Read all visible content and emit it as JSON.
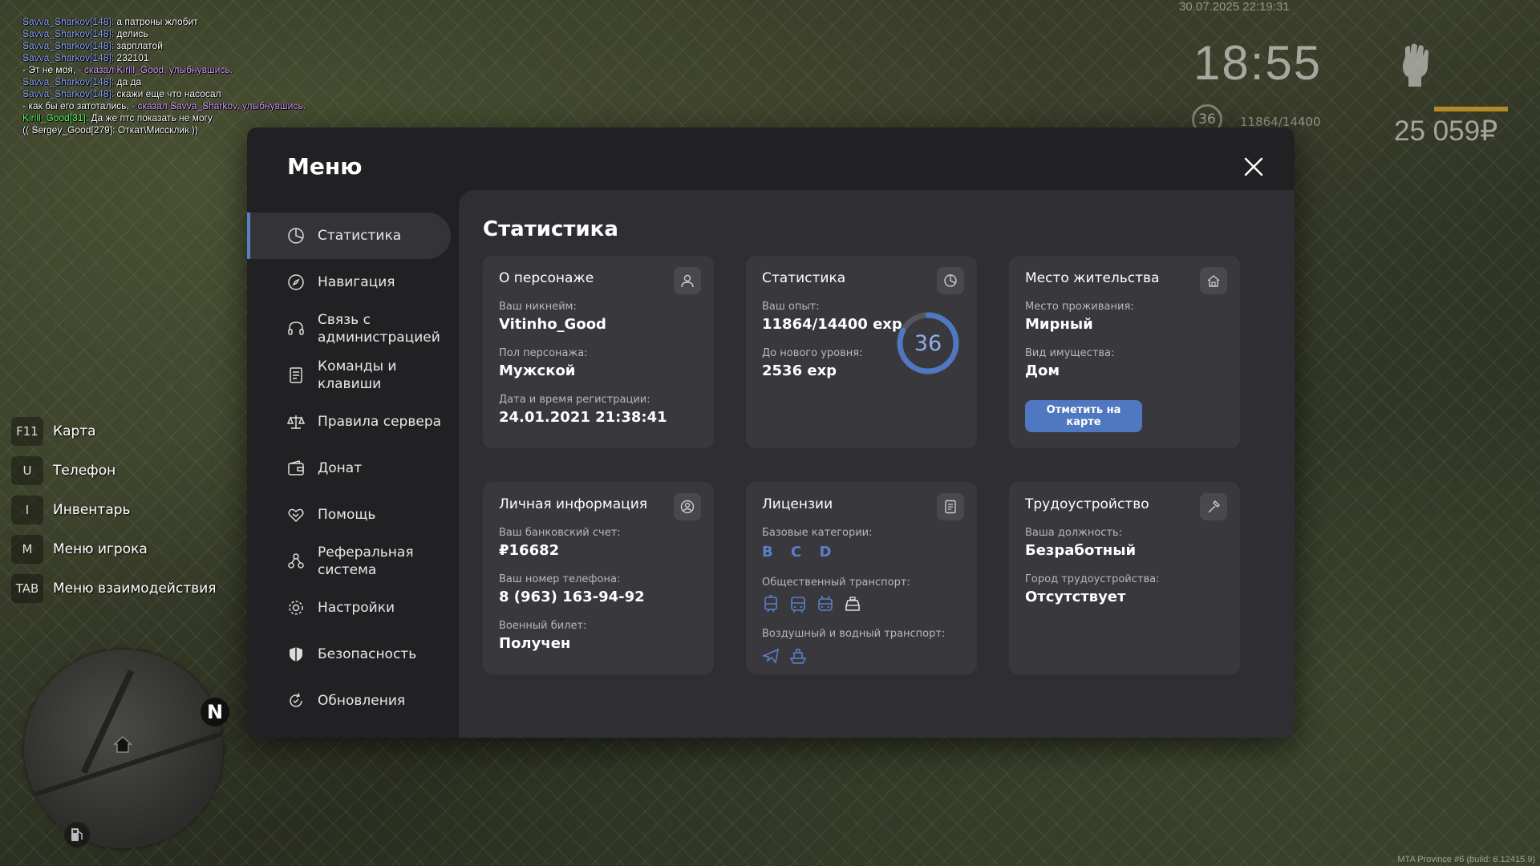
{
  "chat": [
    {
      "nick": "Savva_Sharkov[148]:",
      "text": " а патроны жлобит"
    },
    {
      "nick": "Savva_Sharkov[148]:",
      "text": " делись"
    },
    {
      "nick": "Savva_Sharkov[148]:",
      "text": " зарплатой"
    },
    {
      "nick": "Savva_Sharkov[148]:",
      "text": " 232101"
    },
    {
      "pre": "- Эт не моя, ",
      "act": "- сказал Kirill_Good, улыбнувшись."
    },
    {
      "nick": "Savva_Sharkov[148]:",
      "text": " да да"
    },
    {
      "nick": "Savva_Sharkov[148]:",
      "text": " скажи еще что насосал"
    },
    {
      "pre": "- как бы его затотались, ",
      "act": "- сказал Savva_Sharkov, улыбнувшись."
    },
    {
      "nick2": "Kirill_Good[31]:",
      "text": " Да же птс показать не могу"
    },
    {
      "pre": "(( Sergey_Good[279]: Откат\\Миссклик ))",
      "act": ""
    }
  ],
  "hud": {
    "datetime": "30.07.2025 22:19:31",
    "time": "18:55",
    "level": "36",
    "exp": "11864/14400",
    "money": "25 059₽",
    "compass": "N",
    "build": "MTA Province #6 (build: 6.12415.9)"
  },
  "binds": [
    {
      "key": "F11",
      "label": "Карта"
    },
    {
      "key": "U",
      "label": "Телефон"
    },
    {
      "key": "I",
      "label": "Инвентарь"
    },
    {
      "key": "M",
      "label": "Меню игрока"
    },
    {
      "key": "TAB",
      "label": "Меню взаимодействия"
    }
  ],
  "menu": {
    "title": "Меню",
    "section_title": "Статистика",
    "nav": [
      {
        "label": "Статистика",
        "icon": "pie-chart-icon"
      },
      {
        "label": "Навигация",
        "icon": "compass-icon"
      },
      {
        "label": "Связь с администрацией",
        "icon": "headset-icon"
      },
      {
        "label": "Команды и клавиши",
        "icon": "document-icon"
      },
      {
        "label": "Правила сервера",
        "icon": "scales-icon"
      },
      {
        "label": "Донат",
        "icon": "wallet-icon"
      },
      {
        "label": "Помощь",
        "icon": "handshake-icon"
      },
      {
        "label": "Реферальная система",
        "icon": "referral-icon"
      },
      {
        "label": "Настройки",
        "icon": "gear-icon"
      },
      {
        "label": "Безопасность",
        "icon": "shield-icon"
      },
      {
        "label": "Обновления",
        "icon": "refresh-icon"
      }
    ],
    "cards": {
      "character": {
        "title": "О персонаже",
        "nick_label": "Ваш никнейм:",
        "nick": "Vitinho_Good",
        "gender_label": "Пол персонажа:",
        "gender": "Мужской",
        "reg_label": "Дата и время регистрации:",
        "reg": "24.01.2021 21:38:41"
      },
      "stats": {
        "title": "Статистика",
        "exp_label": "Ваш опыт:",
        "exp": "11864/14400 exp",
        "next_label": "До нового уровня:",
        "next": "2536 exp",
        "level": "36",
        "progress": 0.8239
      },
      "residence": {
        "title": "Место жительства",
        "place_label": "Место проживания:",
        "place": "Мирный",
        "type_label": "Вид имущества:",
        "type": "Дом",
        "button": "Отметить на карте"
      },
      "personal": {
        "title": "Личная информация",
        "bank_label": "Ваш банковский счет:",
        "bank": "₽16682",
        "phone_label": "Ваш номер телефона:",
        "phone": "8 (963) 163-94-92",
        "military_label": "Военный билет:",
        "military": "Получен"
      },
      "licenses": {
        "title": "Лицензии",
        "base_label": "Базовые категории:",
        "base": "B C D",
        "public_label": "Общественный транспорт:",
        "air_label": "Воздушный и водный транспорт:"
      },
      "job": {
        "title": "Трудоустройство",
        "position_label": "Ваша должность:",
        "position": "Безработный",
        "city_label": "Город трудоустройства:",
        "city": "Отсутствует"
      }
    }
  },
  "colors": {
    "accent": "#5078c0",
    "panel": "#212124",
    "content": "#2f2f33",
    "card": "#38383d"
  }
}
